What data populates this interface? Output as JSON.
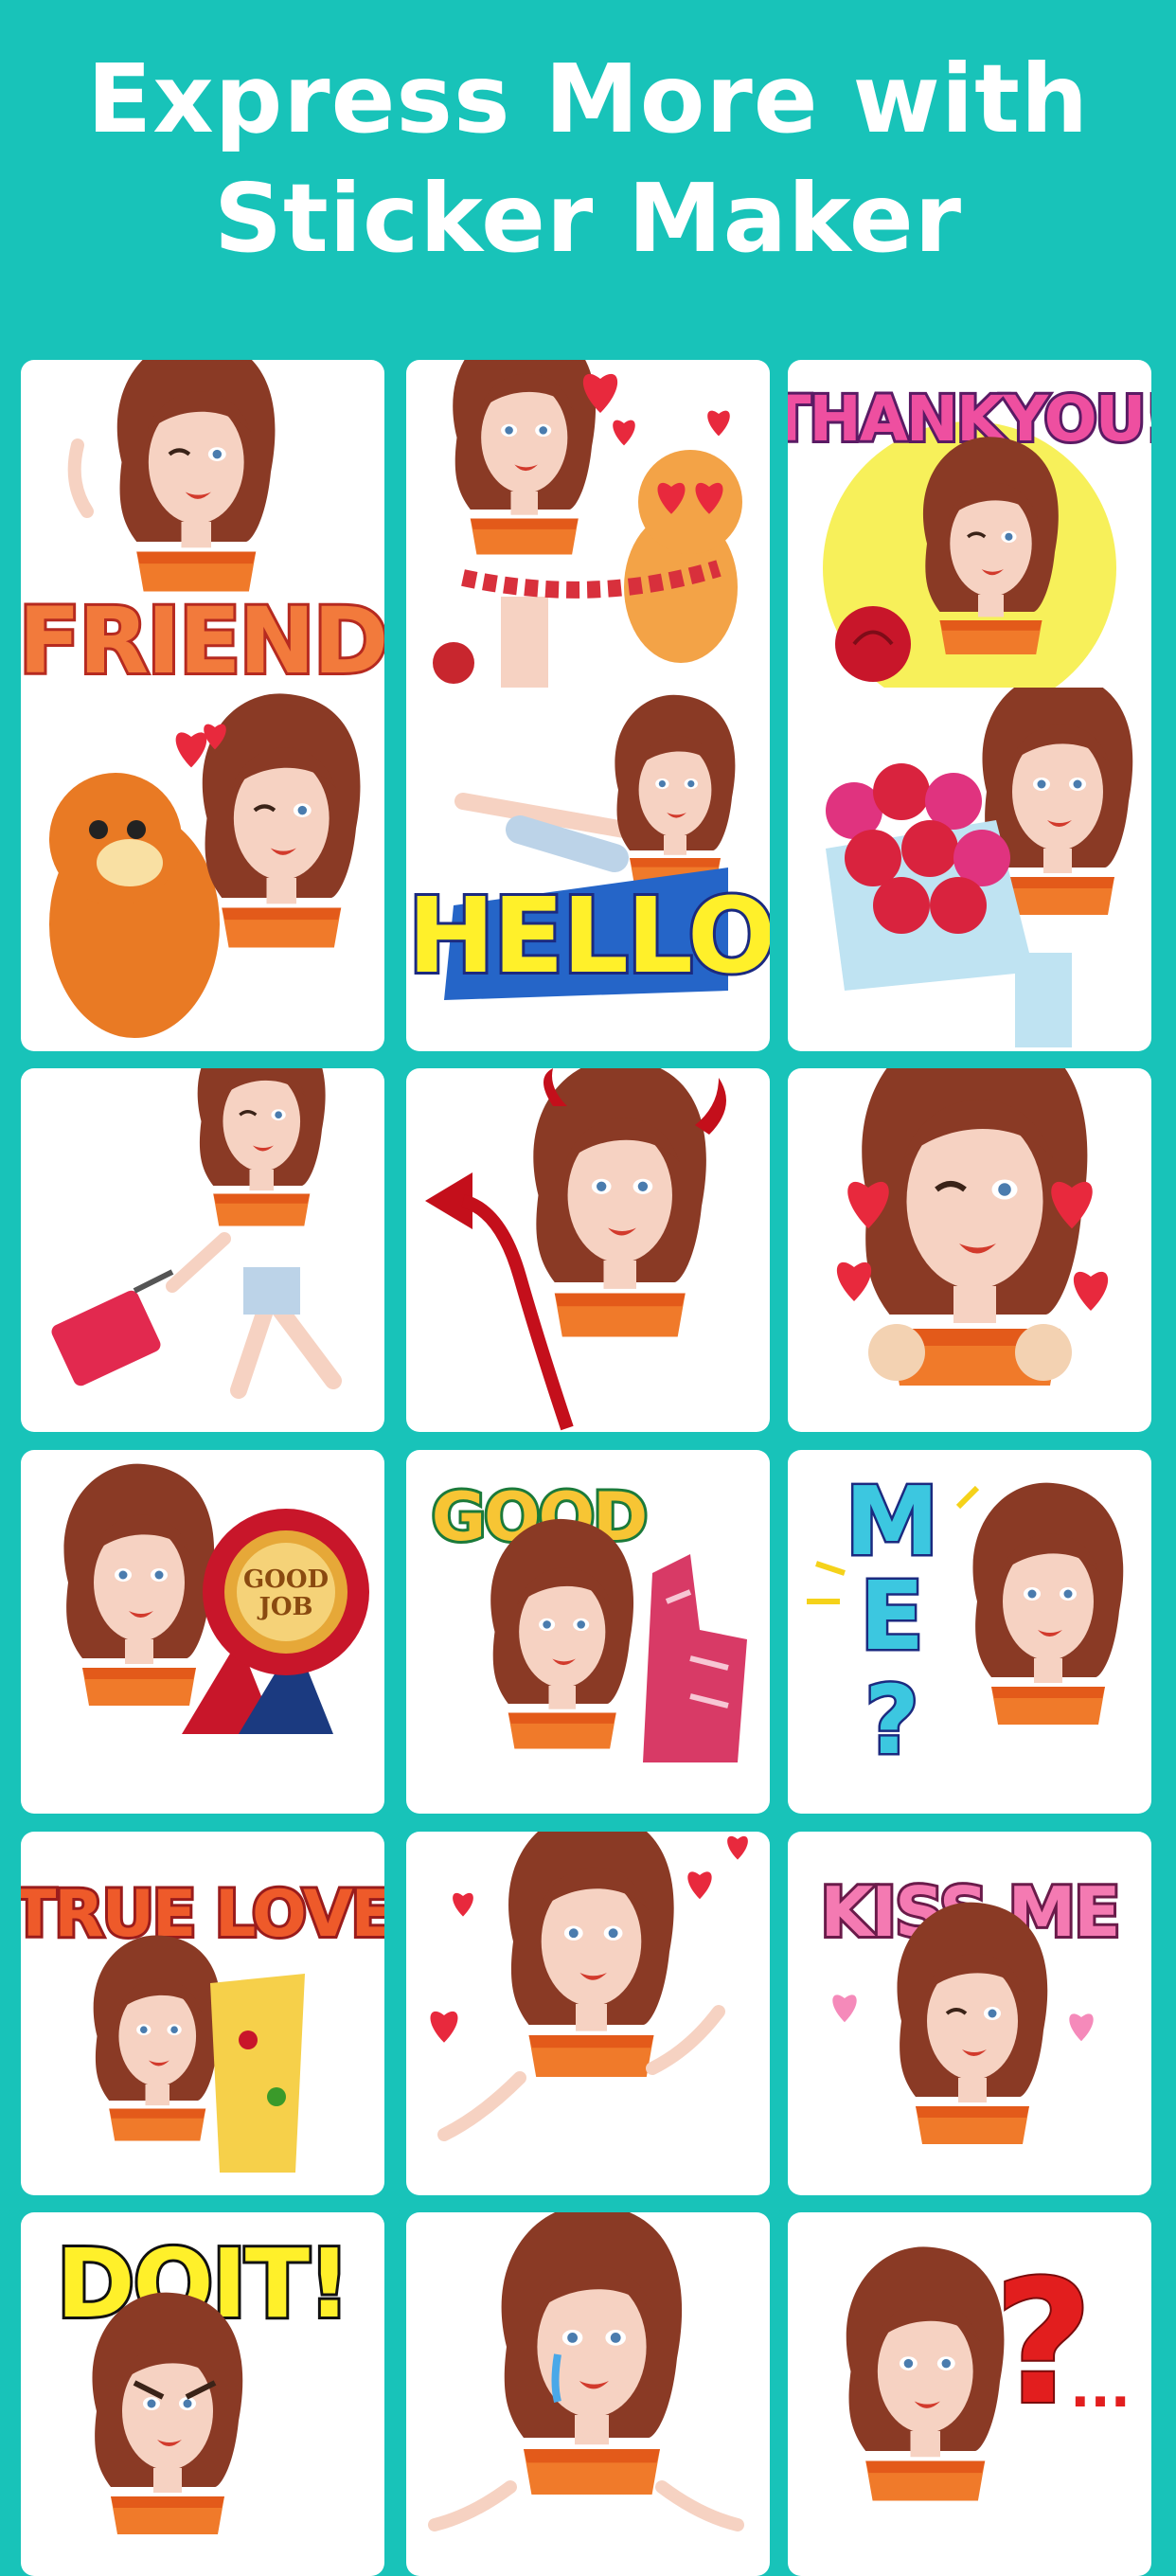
{
  "headline": {
    "line1": "Express More with",
    "line2": "Sticker Maker"
  },
  "colors": {
    "teal": "#18c3b9",
    "white": "#ffffff",
    "hair": "#8a3a25",
    "top": "#f07a2a",
    "skin": "#f6d2c2",
    "heart": "#e8293d"
  },
  "stickers": [
    {
      "id": "friend",
      "text": "FRIEND",
      "icon": "friend-wave-icon"
    },
    {
      "id": "cat-scarf",
      "text": "",
      "icon": "cat-scarf-icon"
    },
    {
      "id": "thank-you",
      "text": "THANKYOU!",
      "icon": "rose-icon"
    },
    {
      "id": "cat-hug",
      "text": "",
      "icon": "cat-hug-icon"
    },
    {
      "id": "hello",
      "text": "HELLO",
      "icon": "hello-icon"
    },
    {
      "id": "flowers",
      "text": "",
      "icon": "bouquet-icon"
    },
    {
      "id": "suitcase",
      "text": "",
      "icon": "suitcase-icon"
    },
    {
      "id": "devil",
      "text": "",
      "icon": "devil-horns-icon"
    },
    {
      "id": "hearts-cat-paws",
      "text": "",
      "icon": "hearts-icon"
    },
    {
      "id": "good-job",
      "text": "GOOD JOB",
      "icon": "medal-icon"
    },
    {
      "id": "good",
      "text": "GOOD",
      "icon": "thumbs-up-icon"
    },
    {
      "id": "me",
      "text": "ME?",
      "icon": "question-icon"
    },
    {
      "id": "true-love",
      "text": "TRUE LOVE",
      "icon": "pizza-icon"
    },
    {
      "id": "hearts-dance",
      "text": "",
      "icon": "hearts-icon"
    },
    {
      "id": "kiss-me",
      "text": "KISS ME",
      "icon": "kiss-icon"
    },
    {
      "id": "do-it",
      "text": "DOIT!",
      "icon": "angry-icon"
    },
    {
      "id": "crying",
      "text": "",
      "icon": "crying-icon"
    },
    {
      "id": "question",
      "text": "?...",
      "icon": "question-mark-icon"
    }
  ]
}
